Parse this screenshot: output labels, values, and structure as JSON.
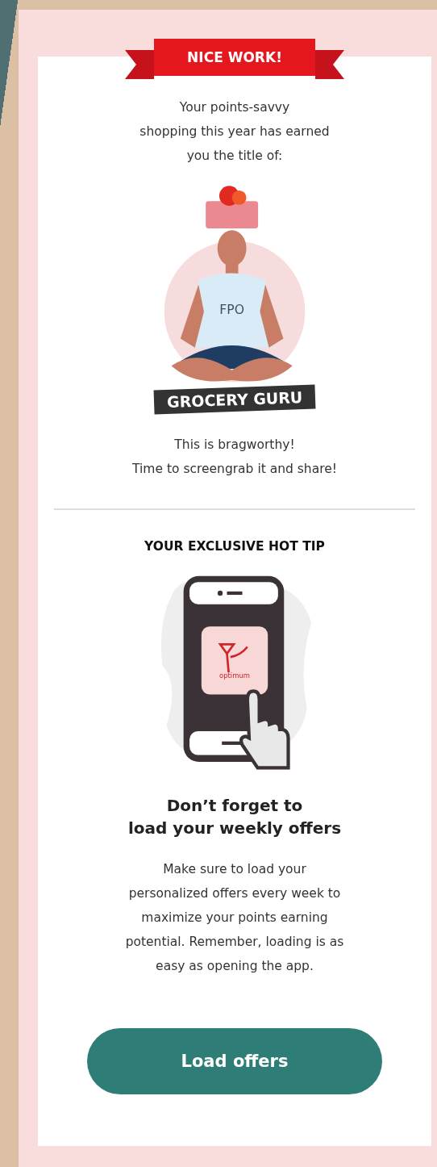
{
  "banner": "NICE WORK!",
  "intro": "Your points-savvy\nshopping this year has earned\nyou the title of:",
  "illustration": {
    "shirt_text": "FPO"
  },
  "award_title": "GROCERY GURU",
  "share_text": "This is bragworthy!\nTime to screengrab it and share!",
  "tip": {
    "heading": "YOUR EXCLUSIVE HOT TIP",
    "app_label": "optimum",
    "title": "Don’t forget to\nload your weekly offers",
    "body": "Make sure to load your\npersonalized offers every week to\nmaximize your points earning\npotential. Remember, loading is as\neasy as opening the app."
  },
  "button": "Load offers"
}
